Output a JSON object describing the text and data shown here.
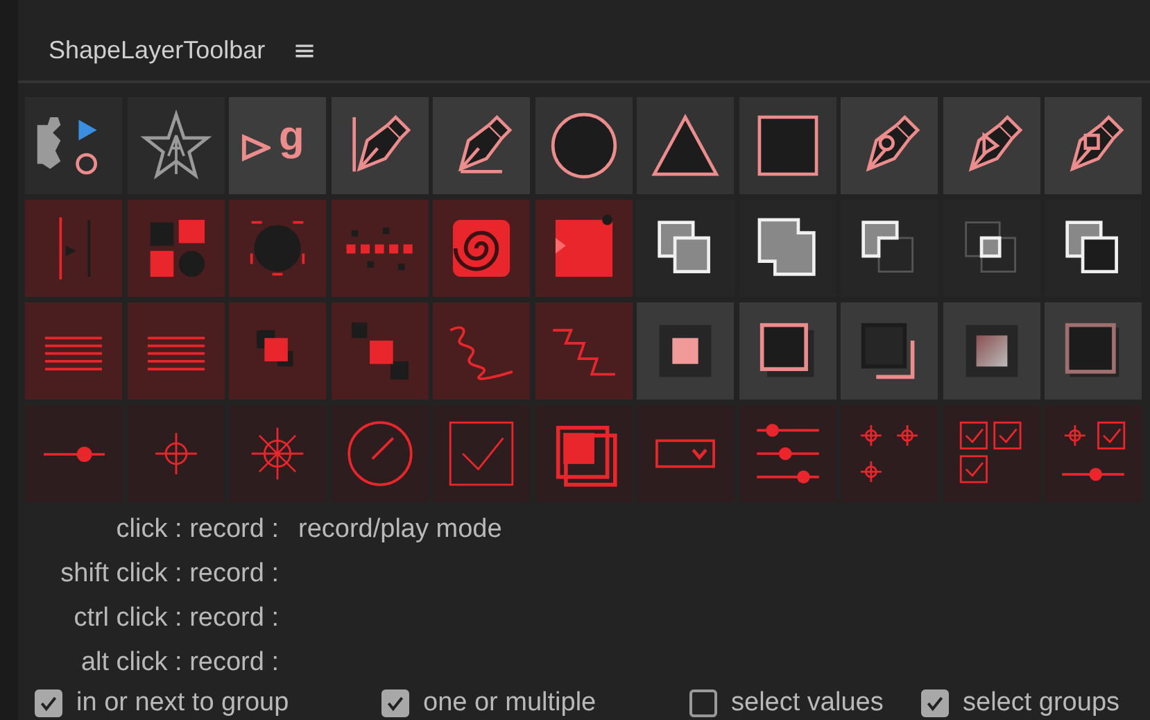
{
  "panel": {
    "title": "ShapeLayerToolbar",
    "menu": "≡"
  },
  "tool_grid": {
    "glyph_text": "g"
  },
  "modifiers": [
    {
      "label": "click : record :",
      "value": "record/play mode"
    },
    {
      "label": "shift click : record :"
    },
    {
      "label": "ctrl click : record :"
    },
    {
      "label": "alt click : record :"
    }
  ],
  "options": [
    {
      "label": "in or next to group",
      "checked": true
    },
    {
      "label": "one or multiple",
      "checked": true
    },
    {
      "label": "select values",
      "checked": false
    },
    {
      "label": "select groups",
      "checked": true
    }
  ]
}
